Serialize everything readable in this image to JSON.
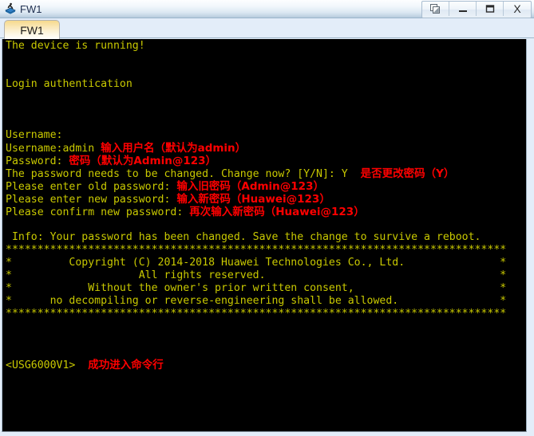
{
  "window": {
    "title": "FW1",
    "icon": "firewall-device-icon",
    "controls": [
      {
        "name": "restore-button",
        "glyph": "restore-icon"
      },
      {
        "name": "minimize-button",
        "glyph": "minimize-icon"
      },
      {
        "name": "maximize-button",
        "glyph": "maximize-icon"
      },
      {
        "name": "close-button",
        "glyph": "close-icon",
        "label": "X"
      }
    ]
  },
  "tabs": [
    {
      "label": "FW1",
      "active": true
    }
  ],
  "terminal": {
    "colors": {
      "background": "#000000",
      "text": "#c9c900",
      "annotation": "#ff0000"
    },
    "lines": [
      {
        "text": "The device is running!",
        "note": ""
      },
      {
        "text": "",
        "note": ""
      },
      {
        "text": "",
        "note": ""
      },
      {
        "text": "Login authentication",
        "note": ""
      },
      {
        "text": "",
        "note": ""
      },
      {
        "text": "",
        "note": ""
      },
      {
        "text": "",
        "note": ""
      },
      {
        "text": "Username:",
        "note": ""
      },
      {
        "text": "Username:admin ",
        "note": "输入用户名（默认为admin）"
      },
      {
        "text": "Password: ",
        "note": "密码（默认为Admin@123）"
      },
      {
        "text": "The password needs to be changed. Change now? [Y/N]: Y  ",
        "note": "是否更改密码（Y）"
      },
      {
        "text": "Please enter old password: ",
        "note": "输入旧密码（Admin@123）"
      },
      {
        "text": "Please enter new password: ",
        "note": "输入新密码（Huawei@123）"
      },
      {
        "text": "Please confirm new password: ",
        "note": "再次输入新密码（Huawei@123）"
      },
      {
        "text": "",
        "note": ""
      },
      {
        "text": " Info: Your password has been changed. Save the change to survive a reboot.",
        "note": ""
      },
      {
        "text": "*******************************************************************************",
        "note": ""
      },
      {
        "text": "*         Copyright (C) 2014-2018 Huawei Technologies Co., Ltd.               *",
        "note": ""
      },
      {
        "text": "*                    All rights reserved.                                     *",
        "note": ""
      },
      {
        "text": "*            Without the owner's prior written consent,                       *",
        "note": ""
      },
      {
        "text": "*      no decompiling or reverse-engineering shall be allowed.                *",
        "note": ""
      },
      {
        "text": "*******************************************************************************",
        "note": ""
      },
      {
        "text": "",
        "note": ""
      },
      {
        "text": "",
        "note": ""
      },
      {
        "text": "",
        "note": ""
      },
      {
        "text": "<USG6000V1>  ",
        "note": "成功进入命令行"
      }
    ]
  }
}
